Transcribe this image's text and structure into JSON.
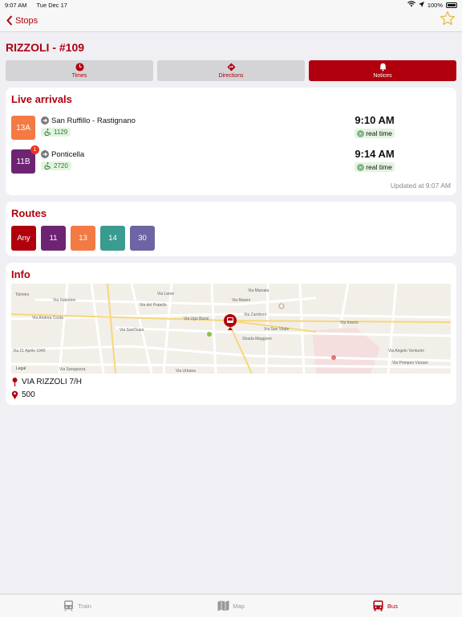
{
  "status": {
    "time": "9:07 AM",
    "date": "Tue Dec 17",
    "battery": "100%"
  },
  "nav": {
    "back_label": "Stops"
  },
  "stop": {
    "title": "RIZZOLI - #109"
  },
  "segments": [
    {
      "label": "Times",
      "active": false,
      "icon": "clock-icon"
    },
    {
      "label": "Directions",
      "active": false,
      "icon": "directions-icon"
    },
    {
      "label": "Notices",
      "active": true,
      "icon": "bell-icon"
    }
  ],
  "arrivals": {
    "title": "Live arrivals",
    "items": [
      {
        "line": "13A",
        "color": "#f47a45",
        "notification": "",
        "destination": "San Ruffillo - Rastignano",
        "vehicle": "1129",
        "time": "9:10 AM",
        "realtime": "real time"
      },
      {
        "line": "11B",
        "color": "#6e2472",
        "notification": "1",
        "destination": "Ponticella",
        "vehicle": "2720",
        "time": "9:14 AM",
        "realtime": "real time"
      }
    ],
    "updated": "Updated at 9:07 AM"
  },
  "routes": {
    "title": "Routes",
    "items": [
      {
        "label": "Any",
        "color": "#b0000e"
      },
      {
        "label": "11",
        "color": "#6e2472"
      },
      {
        "label": "13",
        "color": "#f47a45"
      },
      {
        "label": "14",
        "color": "#3a9b91"
      },
      {
        "label": "30",
        "color": "#6d65a3"
      }
    ]
  },
  "info": {
    "title": "Info",
    "address": "VIA RIZZOLI 7/H",
    "distance": "500",
    "map_labels": {
      "sabotino": "Via Sabotino",
      "costa": "Via Andrea Costa",
      "isaia": "Via Sant'Isaia",
      "pratello": "Via del Pratello",
      "vitale": "Via San Vitale",
      "maggiore": "Strada Maggiore",
      "urbana": "Via Urbana",
      "aprile": "Via 21 Aprile 1945",
      "saragozza": "Via Saragozza",
      "tolmino": "Tolmino",
      "bassi": "Via Ugo Bassi",
      "masini": "Via Masini",
      "zamboni": "Via Zamboni",
      "irnerio": "Via Irnerio",
      "venturini": "Via Angelo Venturini",
      "vizzani": "Via Pompeo Vizzani",
      "lame": "Via Lame",
      "marsala": "Via Marsala",
      "legal": "Legal"
    }
  },
  "tabs": [
    {
      "label": "Train",
      "active": false
    },
    {
      "label": "Map",
      "active": false
    },
    {
      "label": "Bus",
      "active": true
    }
  ],
  "colors": {
    "accent": "#b0000e",
    "realtime_bg": "#e3f4e1"
  }
}
